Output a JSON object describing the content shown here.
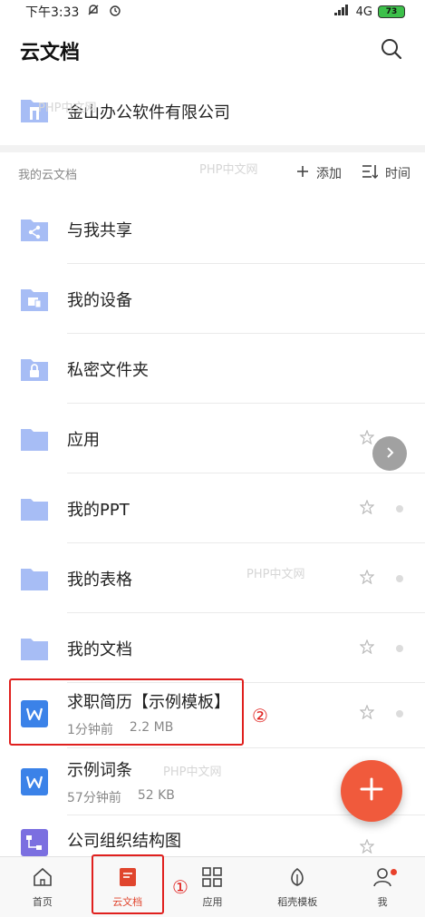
{
  "status_bar": {
    "time": "下午3:33",
    "network": "4G",
    "battery": "73"
  },
  "header": {
    "title": "云文档"
  },
  "company": {
    "name": "金山办公软件有限公司"
  },
  "section": {
    "title": "我的云文档",
    "add_label": "添加",
    "sort_label": "时间"
  },
  "items": [
    {
      "name": "与我共享",
      "icon": "share-folder-icon"
    },
    {
      "name": "我的设备",
      "icon": "device-folder-icon"
    },
    {
      "name": "私密文件夹",
      "icon": "lock-folder-icon"
    },
    {
      "name": "应用",
      "icon": "folder-icon"
    },
    {
      "name": "我的PPT",
      "icon": "folder-icon"
    },
    {
      "name": "我的表格",
      "icon": "folder-icon"
    },
    {
      "name": "我的文档",
      "icon": "folder-icon"
    },
    {
      "name": "求职简历【示例模板】",
      "time": "1分钟前",
      "size": "2.2 MB",
      "icon": "word-doc-icon"
    },
    {
      "name": "示例词条",
      "time": "57分钟前",
      "size": "52 KB",
      "icon": "word-doc-icon"
    },
    {
      "name": "公司组织结构图",
      "icon": "mindmap-icon"
    }
  ],
  "annotations": {
    "one": "①",
    "two": "②"
  },
  "watermarks": [
    "PHP中文网",
    "PHP中文网",
    "PHP中文网",
    "PHP中文网"
  ],
  "tabs": [
    {
      "label": "首页",
      "icon": "home-icon"
    },
    {
      "label": "云文档",
      "icon": "cloud-doc-icon"
    },
    {
      "label": "应用",
      "icon": "apps-grid-icon"
    },
    {
      "label": "稻壳模板",
      "icon": "leaf-icon"
    },
    {
      "label": "我",
      "icon": "profile-icon"
    }
  ],
  "colors": {
    "accent": "#e0452d",
    "folder": "#a7bdf5",
    "word_icon": "#3b82e8",
    "fab": "#f05a3c",
    "annotation_red": "#e0201e"
  }
}
